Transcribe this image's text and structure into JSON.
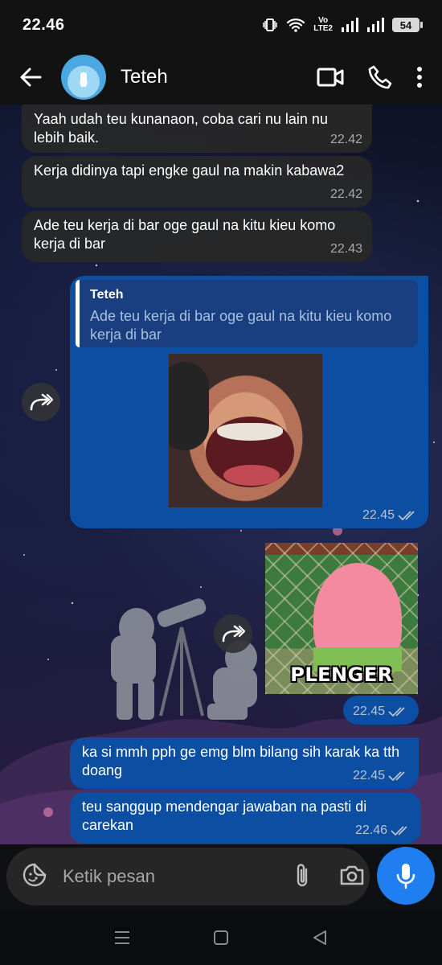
{
  "status_bar": {
    "time": "22.46",
    "network_label_top": "Vo",
    "network_label_bottom": "LTE2",
    "battery": "54"
  },
  "header": {
    "contact_name": "Teteh"
  },
  "messages": [
    {
      "direction": "in",
      "text": "Yaah udah teu kunanaon, coba cari nu lain nu lebih baik.",
      "time": "22.42"
    },
    {
      "direction": "in",
      "text": "Kerja didinya tapi engke gaul na makin kabawa2",
      "time": "22.42"
    },
    {
      "direction": "in",
      "text": "Ade teu kerja di bar oge gaul na kitu kieu komo kerja di bar",
      "time": "22.43"
    },
    {
      "direction": "out",
      "type": "image-reply",
      "reply_to_author": "Teteh",
      "reply_to_text": "Ade teu kerja di bar oge gaul na kitu kieu komo kerja di bar",
      "time": "22.45"
    },
    {
      "direction": "out",
      "type": "image",
      "image_caption": "PLENGER",
      "time": "22.45"
    },
    {
      "direction": "out",
      "text": "ka si mmh pph ge emg blm bilang sih karak ka tth doang",
      "time": "22.45"
    },
    {
      "direction": "out",
      "text": "teu sanggup mendengar jawaban na pasti di carekan",
      "time": "22.46"
    }
  ],
  "composer": {
    "placeholder": "Ketik pesan"
  },
  "icons": {
    "back": "arrow-left-icon",
    "video": "video-call-icon",
    "call": "phone-icon",
    "menu": "more-vertical-icon",
    "forward": "forward-icon",
    "sticker": "sticker-icon",
    "attach": "paperclip-icon",
    "camera": "camera-icon",
    "mic": "mic-icon"
  },
  "colors": {
    "incoming_bubble": "#282828",
    "outgoing_bubble": "#0b4ea2",
    "mic_button": "#1f7ff0"
  }
}
